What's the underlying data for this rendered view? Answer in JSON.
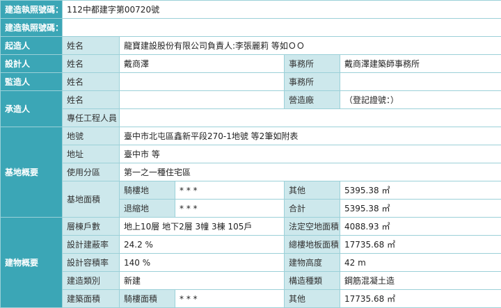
{
  "permit": {
    "no_label": "建造執照號碼：",
    "no_value": "112中都建字第00720號",
    "no2_label": "建造執照號碼："
  },
  "applicant": {
    "title": "起造人",
    "name_label": "姓名",
    "name_value": "龍寶建設股份有限公司負責人:李張麗莉 等如ＯＯ"
  },
  "designer": {
    "title": "設計人",
    "name_label": "姓名",
    "name_value": "戴商澤",
    "office_label": "事務所",
    "office_value": "戴商澤建築師事務所"
  },
  "supervisor": {
    "title": "監造人",
    "name_label": "姓名",
    "office_label": "事務所"
  },
  "contractor": {
    "title": "承造人",
    "name_label": "姓名",
    "firm_label": "營造廠",
    "firm_value": "（登記證號：）",
    "engineer_label": "專任工程人員"
  },
  "site": {
    "title": "基地概要",
    "lot_label": "地號",
    "lot_value": "臺中市北屯區鑫新平段270-1地號 等2筆如附表",
    "address_label": "地址",
    "address_value": "臺中市 等",
    "zoning_label": "使用分區",
    "zoning_value": "第一之一種住宅區",
    "area_label": "基地面積",
    "arcade_label": "騎樓地",
    "arcade_value": "* * *",
    "other_label": "其他",
    "other_value": "5395.38 ㎡",
    "setback_label": "退縮地",
    "setback_value": "* * *",
    "total_label": "合計",
    "total_value": "5395.38 ㎡"
  },
  "building": {
    "title": "建物概要",
    "floors_label": "層棟戶數",
    "floors_value": "地上10層 地下2層 3幢 3棟 105戶",
    "open_label": "法定空地面積",
    "open_value": "4088.93 ㎡",
    "coverage_label": "設計建蔽率",
    "coverage_value": "24.2 %",
    "floor_area_label": "總樓地板面積",
    "floor_area_value": "17735.68 ㎡",
    "far_label": "設計容積率",
    "far_value": "140 %",
    "height_label": "建物高度",
    "height_value": "42 m",
    "type_label": "建造類別",
    "type_value": "新建",
    "structure_label": "構造種類",
    "structure_value": "鋼筋混凝土造",
    "build_area_label": "建築面積",
    "arcade_area_label": "騎樓面積",
    "arcade_area_value": "* * *",
    "other_label": "其他",
    "other_value": "17735.68 ㎡"
  }
}
